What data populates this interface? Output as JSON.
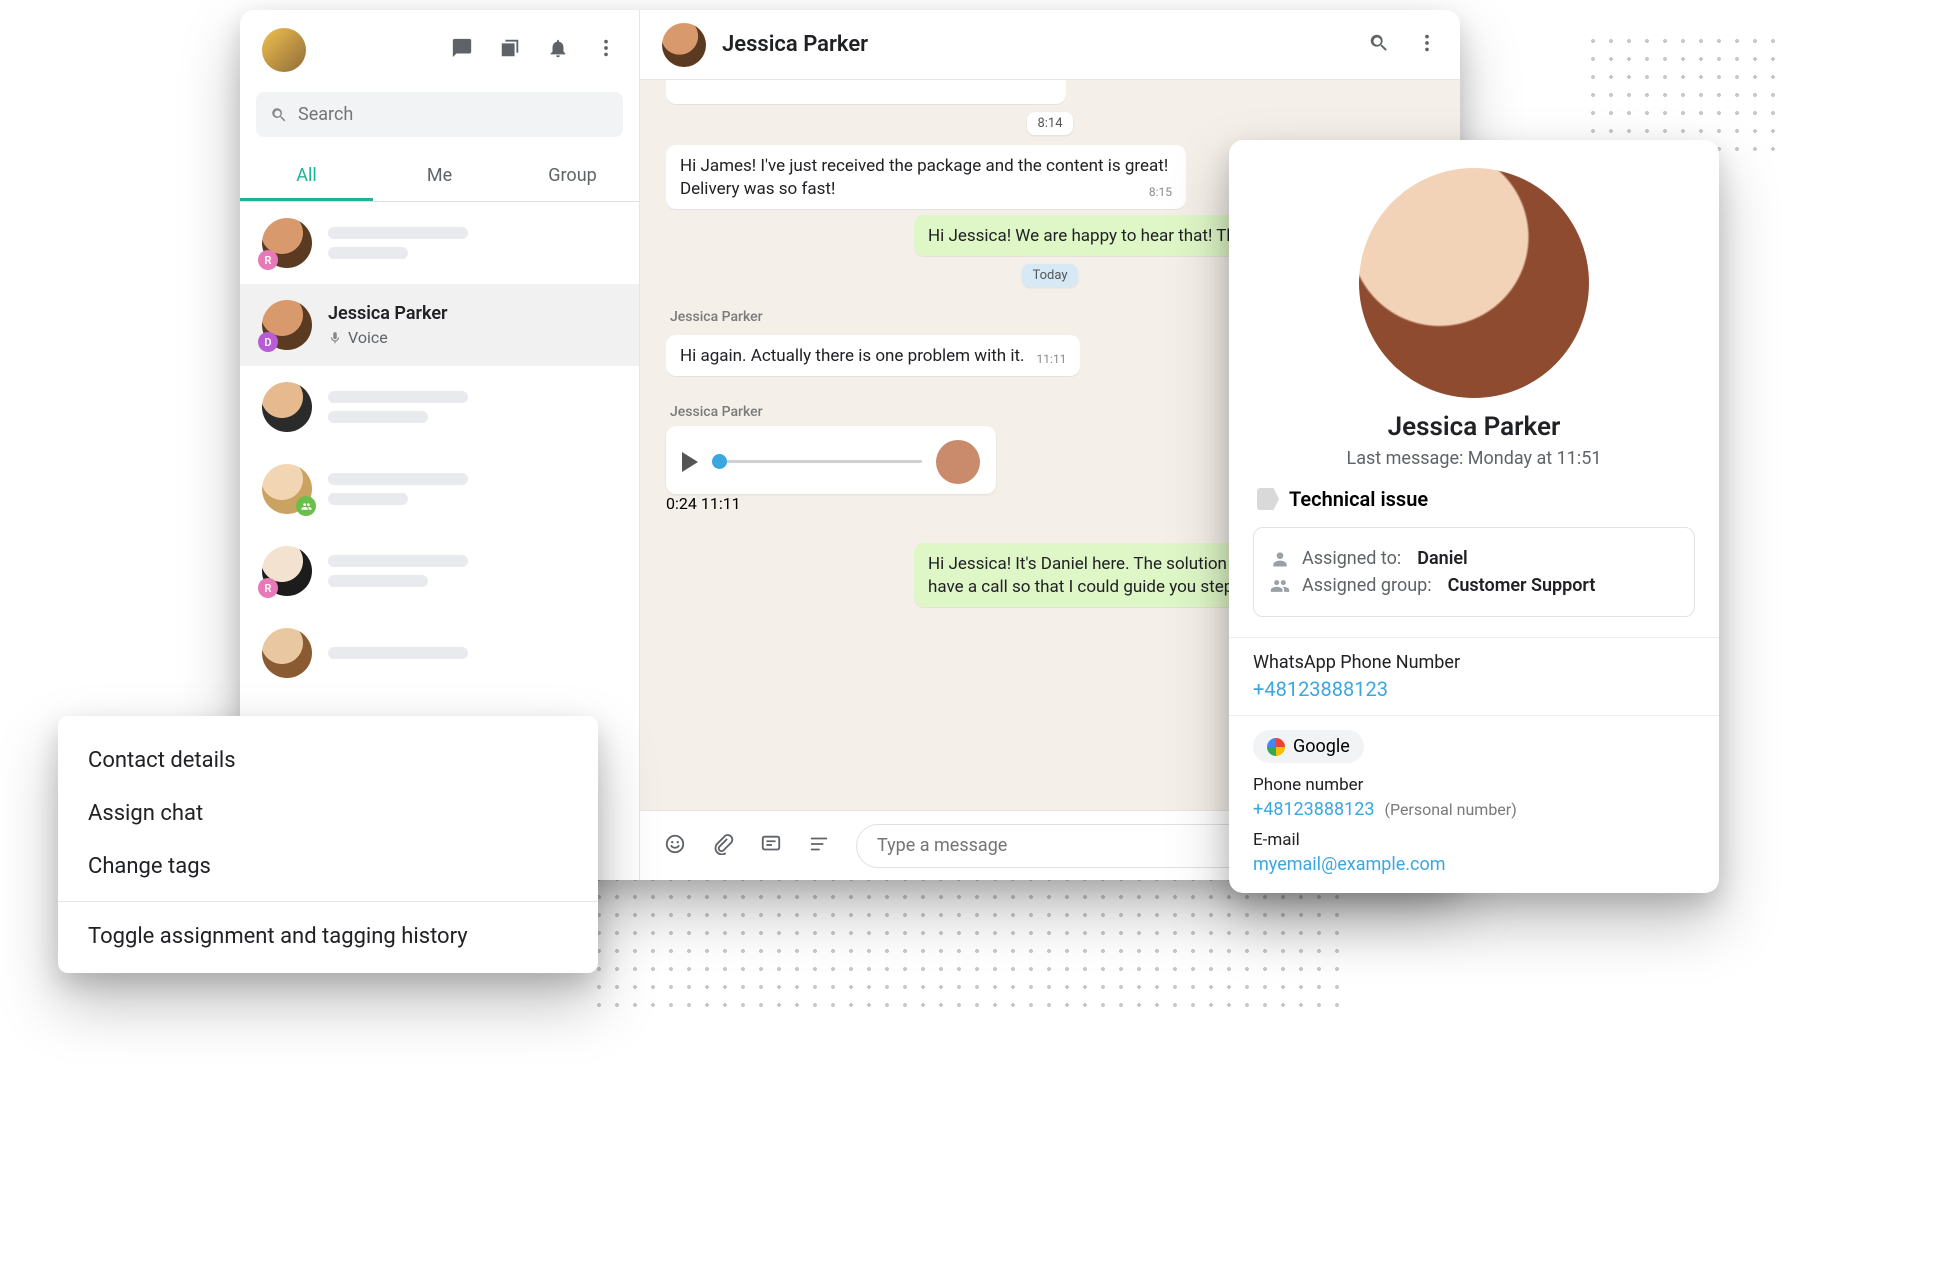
{
  "sidebar": {
    "search_placeholder": "Search",
    "tabs": {
      "all": "All",
      "me": "Me",
      "group": "Group"
    },
    "selected": {
      "name": "Jessica Parker",
      "subtitle": "Voice"
    },
    "badges": {
      "r": "R",
      "d": "D"
    }
  },
  "chat": {
    "header_name": "Jessica Parker",
    "chips": {
      "first": "8:14",
      "today": "Today"
    },
    "messages": {
      "m1": {
        "text": "Hi James! I've just received the package and the content is great! Delivery was so fast!",
        "ts": "8:15"
      },
      "m2": {
        "text": "Hi Jessica! We are happy to hear that! Thank you for your order!"
      },
      "author3": "Jessica Parker",
      "m3": {
        "text": "Hi again. Actually there is one problem with it.",
        "ts": "11:11"
      },
      "author4": "Jessica Parker",
      "voice": {
        "elapsed": "0:24",
        "ts": "11:11"
      },
      "m5": {
        "text": "Hi Jessica! It's Daniel here. The solution is quite simple. Shall we have a call so that I could guide you step by step?"
      }
    },
    "composer_placeholder": "Type a message"
  },
  "context_menu": {
    "i1": "Contact details",
    "i2": "Assign chat",
    "i3": "Change tags",
    "i4": "Toggle assignment and tagging history"
  },
  "detail": {
    "name": "Jessica Parker",
    "last_message": "Last message: Monday at 11:51",
    "tag": "Technical issue",
    "assigned_to_label": "Assigned to:",
    "assigned_to": "Daniel",
    "assigned_group_label": "Assigned group:",
    "assigned_group": "Customer Support",
    "wa_label": "WhatsApp Phone Number",
    "wa_number": "+48123888123",
    "google_label": "Google",
    "phone_label": "Phone number",
    "phone_number": "+48123888123",
    "phone_note": "(Personal number)",
    "email_label": "E-mail",
    "email": "myemail@example.com"
  }
}
